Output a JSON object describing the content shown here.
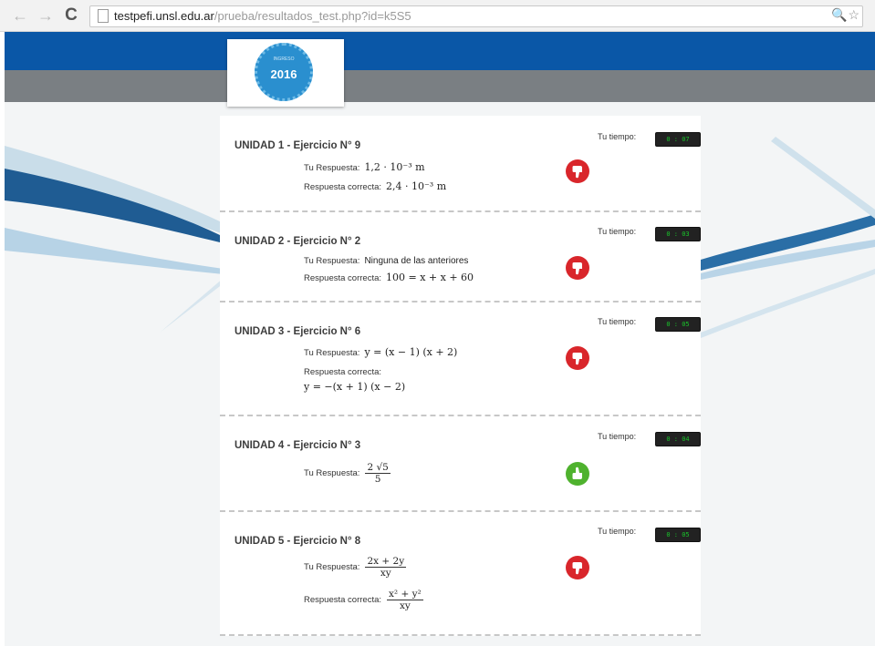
{
  "browser": {
    "back_icon": "←",
    "forward_icon": "→",
    "reload_icon": "C",
    "url_host": "testpefi.unsl.edu.ar",
    "url_path": "/prueba/resultados_test.php?id=k5S5",
    "zoom_icon": "🔍",
    "star_icon": "☆"
  },
  "logo": {
    "year": "2016",
    "subtitle": "INGRESO"
  },
  "results": [
    {
      "title": "UNIDAD 1 - Ejercicio N° 9",
      "time_label": "Tu tiempo:",
      "time": "0 : 07",
      "your_answer_label": "Tu Respuesta:",
      "your_answer": "1,2 · 10⁻³ m",
      "correct_label": "Respuesta correcta:",
      "correct_answer": "2,4 · 10⁻³ m",
      "result": "incorrect"
    },
    {
      "title": "UNIDAD 2 - Ejercicio N° 2",
      "time_label": "Tu tiempo:",
      "time": "0 : 03",
      "your_answer_label": "Tu Respuesta:",
      "your_answer": "Ninguna de las anteriores",
      "correct_label": "Respuesta correcta:",
      "correct_answer": "100 = x + x + 60",
      "result": "incorrect"
    },
    {
      "title": "UNIDAD 3 - Ejercicio N° 6",
      "time_label": "Tu tiempo:",
      "time": "0 : 05",
      "your_answer_label": "Tu Respuesta:",
      "your_answer": "y = (x − 1) (x + 2)",
      "correct_label": "Respuesta correcta:",
      "correct_answer": "y = −(x + 1) (x − 2)",
      "result": "incorrect"
    },
    {
      "title": "UNIDAD 4 - Ejercicio N° 3",
      "time_label": "Tu tiempo:",
      "time": "0 : 04",
      "your_answer_label": "Tu Respuesta:",
      "your_answer_num": "2 √5",
      "your_answer_den": "5",
      "result": "correct"
    },
    {
      "title": "UNIDAD 5 - Ejercicio N° 8",
      "time_label": "Tu tiempo:",
      "time": "0 : 05",
      "your_answer_label": "Tu Respuesta:",
      "your_answer_num": "2x + 2y",
      "your_answer_den": "xy",
      "correct_label": "Respuesta correcta:",
      "correct_answer_num": "x² + y²",
      "correct_answer_den": "xy",
      "result": "incorrect"
    }
  ],
  "colors": {
    "brand_blue": "#0a57a7",
    "band_grey": "#7a7f83",
    "incorrect": "#d9262b",
    "correct": "#4fb22e",
    "timer_digits": "#19c42b"
  }
}
